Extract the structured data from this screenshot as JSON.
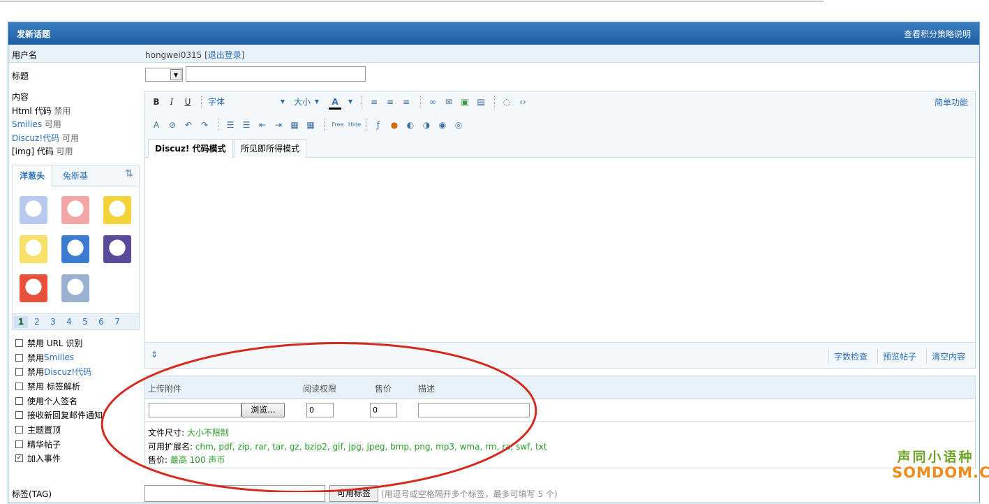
{
  "header": {
    "title": "发新话题",
    "right_link": "查看积分策略说明"
  },
  "user": {
    "label": "用户名",
    "name": "hongwei0315",
    "open_bracket": " [",
    "logout": "退出登录",
    "close_bracket": "]"
  },
  "subject": {
    "label": "标题"
  },
  "content": {
    "label": "内容",
    "html_label": "Html 代码",
    "html_state": "禁用",
    "smilies_label": "Smilies",
    "smilies_state": "可用",
    "discuz_label": "Discuz!代码",
    "discuz_state": "可用",
    "img_label": "[img] 代码",
    "img_state": "可用"
  },
  "smilies": {
    "tabs": [
      "洋葱头",
      "兔斯基"
    ],
    "pages": [
      "1",
      "2",
      "3",
      "4",
      "5",
      "6",
      "7"
    ],
    "colors": [
      "#b8c8ee",
      "#f2a6a6",
      "#f4d23a",
      "#f7e16a",
      "#3b7bd0",
      "#5b4a9a",
      "#e8503c",
      "#9ab0d0",
      "#ffffff"
    ]
  },
  "options": [
    {
      "pre": "禁用 URL 识别",
      "link": "",
      "checked": false
    },
    {
      "pre": "禁用 ",
      "link": "Smilies",
      "checked": false
    },
    {
      "pre": "禁用 ",
      "link": "Discuz!代码",
      "checked": false
    },
    {
      "pre": "禁用 标签解析",
      "link": "",
      "checked": false
    },
    {
      "pre": "使用个人签名",
      "link": "",
      "checked": false
    },
    {
      "pre": "接收新回复邮件通知",
      "link": "",
      "checked": false
    },
    {
      "pre": "主题置顶",
      "link": "",
      "checked": false
    },
    {
      "pre": "精华帖子",
      "link": "",
      "checked": false
    },
    {
      "pre": "加入事件",
      "link": "",
      "checked": true
    }
  ],
  "editor": {
    "bold": "B",
    "italic": "I",
    "underline": "U",
    "font": "字体",
    "size": "大小",
    "color_glyph": "A",
    "simple_mode": "简单功能",
    "tabs": [
      "Discuz! 代码模式",
      "所见即所得模式"
    ],
    "footer": [
      "字数检查",
      "预览帖子",
      "清空内容"
    ]
  },
  "attachment": {
    "headers": [
      "上传附件",
      "阅读权限",
      "售价",
      "描述"
    ],
    "browse": "浏览...",
    "read_perm": "0",
    "price": "0",
    "size_label": "文件尺寸: ",
    "size_value": "大小不限制",
    "ext_label": "可用扩展名: ",
    "ext_value": "chm, pdf, zip, rar, tar, gz, bzip2, gif, jpg, jpeg, bmp, png, mp3, wma, rm, ra, swf, txt",
    "price_label": "售价: ",
    "price_value": "最高 100 声币"
  },
  "tag": {
    "label": "标签(TAG)",
    "button": "可用标签",
    "hint": "(用逗号或空格隔开多个标签，最多可填写 5 个)"
  },
  "watermark": {
    "line1": "声同小语种",
    "line2": "SOMDOM.COM"
  }
}
